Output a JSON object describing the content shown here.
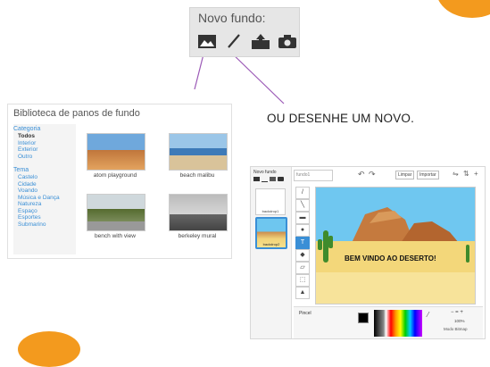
{
  "novo_fundo": {
    "title": "Novo fundo:",
    "icons": [
      "image-icon",
      "brush-icon",
      "upload-icon",
      "camera-icon"
    ]
  },
  "library": {
    "title": "Biblioteca de panos de fundo",
    "categoria_heading": "Categoria",
    "categorias": [
      "Todos",
      "Interior",
      "Exterior",
      "Outro"
    ],
    "tema_heading": "Tema",
    "temas": [
      "Castelo",
      "Cidade",
      "Voando",
      "Música e Dança",
      "Natureza",
      "Espaço",
      "Esportes",
      "Submarino"
    ],
    "thumbs": [
      "atom playground",
      "beach malibu",
      "bench with view",
      "berkeley mural"
    ]
  },
  "caption": "OU DESENHE UM NOVO.",
  "editor": {
    "panel_title": "Novo fundo",
    "search_value": "fundo1",
    "btn_clear": "Limpar",
    "btn_import": "Importar",
    "thumb1_label": "backdrop1",
    "thumb2_label": "backdrop2",
    "canvas_text": "BEM VINDO AO DESERTO!",
    "pen_label": "Pincel",
    "zoom_label": "100%",
    "mode_label": "Modo Bitmap"
  },
  "colors": {
    "accent": "#f39a1e",
    "line": "#9b59b6"
  }
}
